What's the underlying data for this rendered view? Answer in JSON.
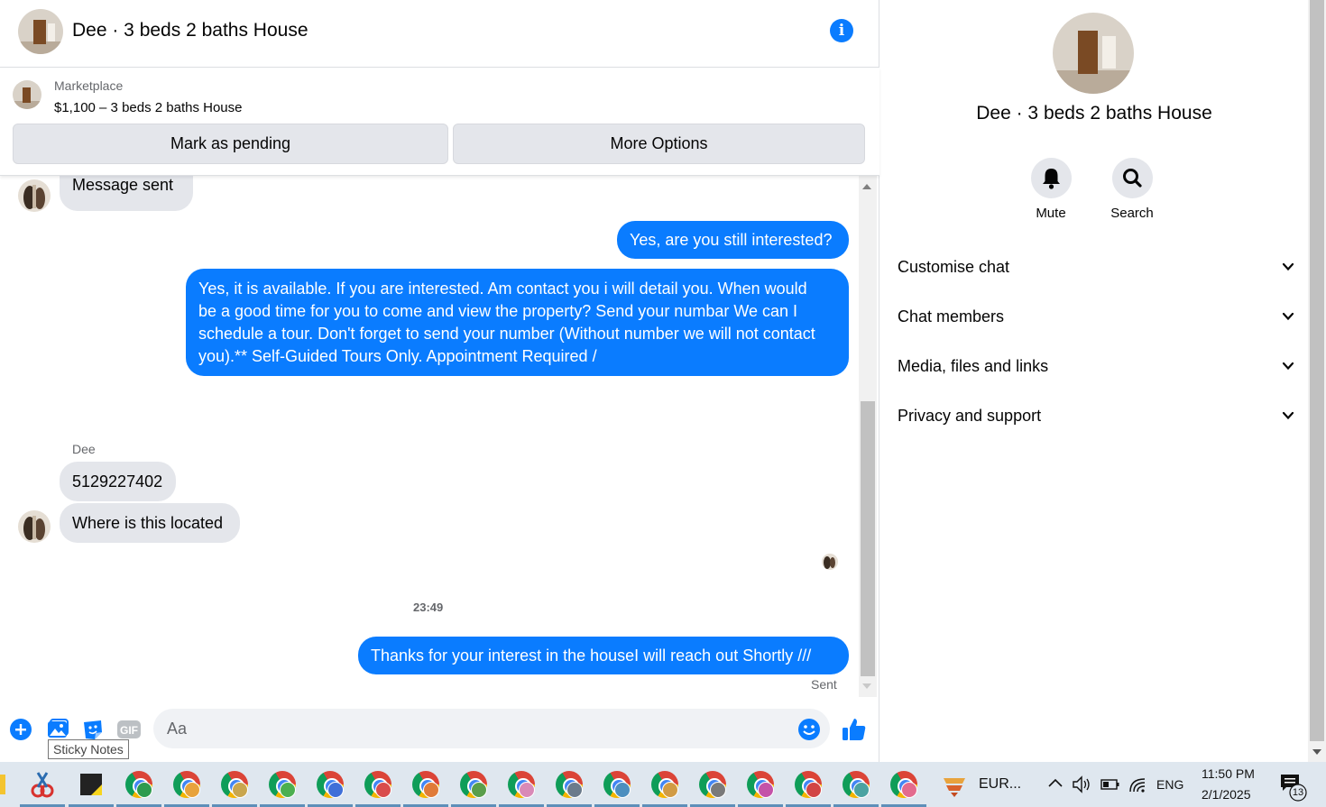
{
  "header": {
    "title": "Dee · 3 beds 2 baths House"
  },
  "listing": {
    "kicker": "Marketplace",
    "price_title": "$1,100 – 3 beds 2 baths House",
    "mark_pending_label": "Mark as pending",
    "more_options_label": "More Options"
  },
  "messages": {
    "msg1": "Message sent",
    "msg2": "Yes, are you still interested?",
    "msg3": "Yes, it is available. If you are interested.  Am contact you i will detail you.  When would be a good time for you to come and view the property? Send your numbar We can I schedule a tour.  Don't forget to send your number (Without number we will not contact you).** Self-Guided Tours Only. Appointment Required /",
    "sender_name": "Dee",
    "msg4": "5129227402",
    "msg5": "Where is this located",
    "timestamp": "23:49",
    "msg6": "Thanks for your interest in the houseI will reach out Shortly ///",
    "status": "Sent"
  },
  "composer": {
    "placeholder": "Aa",
    "gif_label": "GIF",
    "tooltip": "Sticky Notes"
  },
  "info_panel": {
    "name": "Dee · 3 beds 2 baths House",
    "mute_label": "Mute",
    "search_label": "Search",
    "sections": [
      "Customise chat",
      "Chat members",
      "Media, files and links",
      "Privacy and support"
    ]
  },
  "taskbar": {
    "tray_app_label": "EUR...",
    "language": "ENG",
    "time": "11:50 PM",
    "date": "2/1/2025",
    "notification_count": "13"
  },
  "colors": {
    "accent": "#0a7cff",
    "bubble_in": "#e4e6eb",
    "taskbar": "#dfe7ef"
  }
}
